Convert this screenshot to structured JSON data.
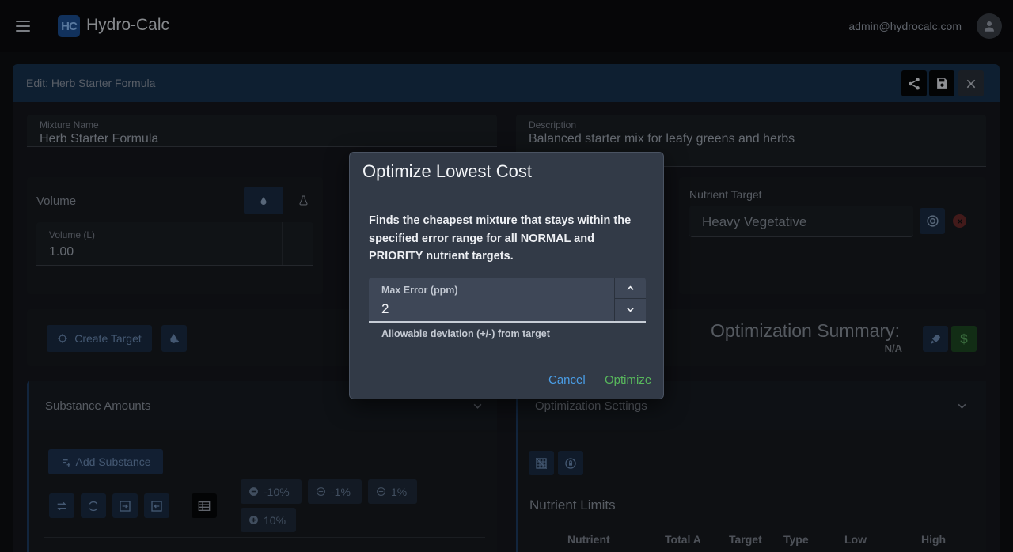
{
  "app": {
    "logo_text": "HC",
    "title": "Hydro-Calc",
    "user_email": "admin@hydrocalc.com"
  },
  "editor": {
    "title": "Edit: Herb Starter Formula",
    "mixture_name_label": "Mixture Name",
    "mixture_name_value": "Herb Starter Formula",
    "description_label": "Description",
    "description_value": "Balanced starter mix for leafy greens and herbs",
    "volume_title": "Volume",
    "volume_field_label": "Volume (L)",
    "volume_field_value": "1.00",
    "nutrient_target_title": "Nutrient Target",
    "nutrient_target_value": "Heavy Vegetative",
    "create_target_label": "Create Target",
    "optimization_summary_title": "Optimization Summary:",
    "optimization_summary_value": "N/A",
    "substance_amounts_title": "Substance Amounts",
    "add_substance_label": "Add Substance",
    "pct_buttons": [
      "-10%",
      "-1%",
      "1%",
      "10%"
    ],
    "optimization_settings_title": "Optimization Settings",
    "nutrient_limits_title": "Nutrient Limits",
    "table_headers": [
      "Nutrient",
      "Total A",
      "Target",
      "Type",
      "Low",
      "High"
    ]
  },
  "dialog": {
    "title": "Optimize Lowest Cost",
    "description": "Finds the cheapest mixture that stays within the specified error range for all NORMAL and PRIORITY nutrient targets.",
    "max_error_label": "Max Error (ppm)",
    "max_error_value": "2",
    "hint": "Allowable deviation (+/-) from target",
    "cancel_label": "Cancel",
    "optimize_label": "Optimize"
  },
  "colors": {
    "brand": "#1c4f95",
    "cancel": "#4a9de6",
    "optimize": "#58b85c",
    "dialog_bg": "#323a47",
    "danger": "#d9534f"
  }
}
